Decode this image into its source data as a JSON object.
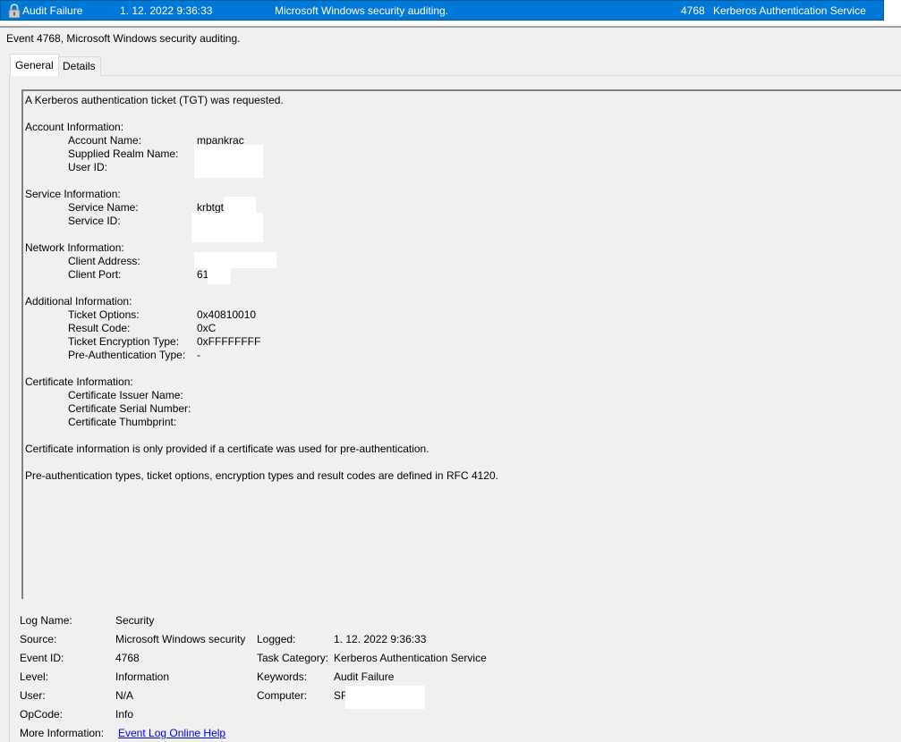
{
  "event_row": {
    "level": "Audit Failure",
    "date_time": "1. 12. 2022 9:36:33",
    "source": "Microsoft Windows security auditing.",
    "event_id": "4768",
    "task_category": "Kerberos Authentication Service",
    "icon": "lock-icon"
  },
  "event_header": "Event 4768, Microsoft Windows security auditing.",
  "tabs": [
    {
      "label": "General",
      "selected": true
    },
    {
      "label": "Details",
      "selected": false
    }
  ],
  "description": {
    "intro": "A Kerberos authentication ticket (TGT) was requested.",
    "account_heading": "Account Information:",
    "account_name_label": "Account Name:",
    "account_name_value": "mpankrac",
    "supplied_realm_label": "Supplied Realm Name:",
    "user_id_label": "User ID:",
    "service_heading": "Service Information:",
    "service_name_label": "Service Name:",
    "service_name_value": "krbtgt",
    "service_id_label": "Service ID:",
    "network_heading": "Network Information:",
    "client_address_label": "Client Address:",
    "client_port_label": "Client Port:",
    "client_port_value": "61",
    "additional_heading": "Additional Information:",
    "ticket_options_label": "Ticket Options:",
    "ticket_options_value": "0x40810010",
    "result_code_label": "Result Code:",
    "result_code_value": "0xC",
    "ticket_encryption_label": "Ticket Encryption Type:",
    "ticket_encryption_value": "0xFFFFFFFF",
    "preauth_type_label": "Pre-Authentication Type:",
    "preauth_type_value": "-",
    "certificate_heading": "Certificate Information:",
    "cert_issuer_label": "Certificate Issuer Name:",
    "cert_serial_label": "Certificate Serial Number:",
    "cert_thumbprint_label": "Certificate Thumbprint:",
    "certificate_note": "Certificate information is only provided if a certificate was used for pre-authentication.",
    "rfc_note": "Pre-authentication types, ticket options, encryption types and result codes are defined in RFC 4120."
  },
  "summary": {
    "log_name_label": "Log Name:",
    "log_name_value": "Security",
    "source_label": "Source:",
    "source_value": "Microsoft Windows security",
    "logged_label": "Logged:",
    "logged_value": "1. 12. 2022 9:36:33",
    "event_id_label": "Event ID:",
    "event_id_value": "4768",
    "task_category_label": "Task Category:",
    "task_category_value": "Kerberos Authentication Service",
    "level_label": "Level:",
    "level_value": "Information",
    "keywords_label": "Keywords:",
    "keywords_value": "Audit Failure",
    "user_label": "User:",
    "user_value": "N/A",
    "computer_label": "Computer:",
    "computer_value": "SR",
    "opcode_label": "OpCode:",
    "opcode_value": "Info",
    "more_info_label": "More Information:",
    "more_info_link": "Event Log Online Help"
  },
  "colors": {
    "selection": "#0078d7",
    "panel": "#f0f0f0",
    "link": "#0000ee"
  }
}
